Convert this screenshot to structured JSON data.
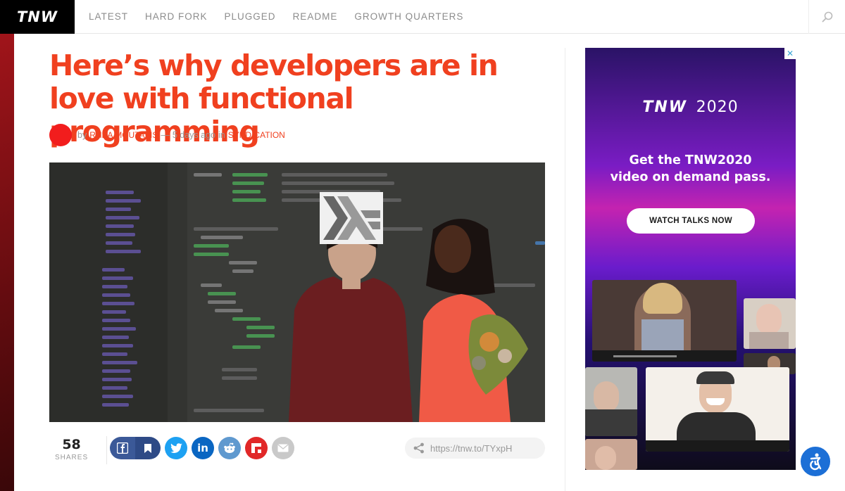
{
  "nav": {
    "logo": "TNW",
    "links": [
      "LATEST",
      "HARD FORK",
      "PLUGGED",
      "README",
      "GROWTH QUARTERS"
    ]
  },
  "article": {
    "title": "Here’s why developers are in love with functional programming",
    "byline": {
      "by": "by",
      "author": "RHEA MOUTAFIS",
      "dash": "—",
      "time": "5 days ago",
      "in": "in",
      "category": "SYNDICATION"
    }
  },
  "share": {
    "count": "58",
    "count_label": "SHARES",
    "short_url": "https://tnw.to/TYxpH",
    "networks": [
      "facebook",
      "bookmark",
      "twitter",
      "linkedin",
      "reddit",
      "flipboard",
      "email"
    ]
  },
  "ad": {
    "close": "✕",
    "logo_text": "TNW",
    "logo_year": "2020",
    "headline_line1": "Get the TNW2020",
    "headline_line2": "video on demand pass.",
    "cta": "WATCH TALKS NOW"
  },
  "colors": {
    "brand_red": "#f0401f",
    "facebook": "#3b5998",
    "twitter": "#1da1f2",
    "linkedin": "#0a66c2",
    "reddit": "#5f99cf",
    "flipboard": "#e12828",
    "email": "#c9c9c9",
    "accessibility": "#1c6fd6"
  }
}
